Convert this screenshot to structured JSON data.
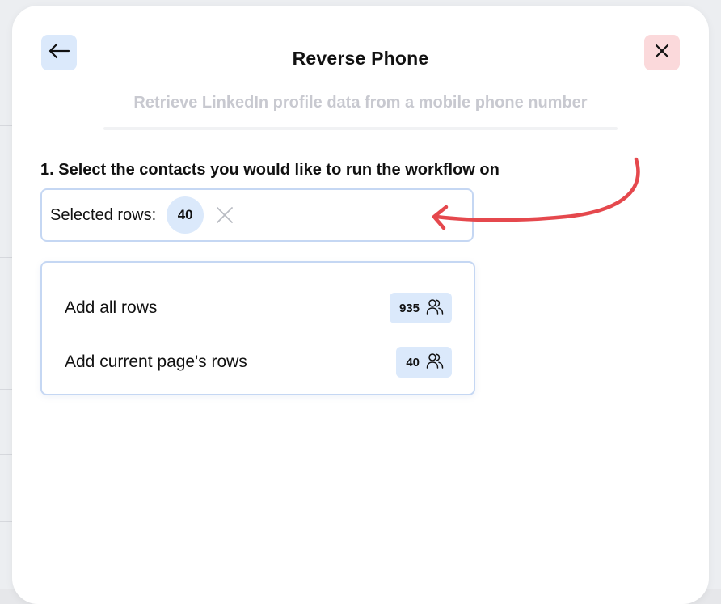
{
  "modal": {
    "title": "Reverse Phone",
    "subtitle": "Retrieve LinkedIn profile data from a mobile phone number"
  },
  "icons": {
    "back": "arrow-left-icon",
    "close": "close-icon",
    "clear": "clear-x-icon",
    "users": "users-icon"
  },
  "step": {
    "label": "1. Select the contacts you would like to run the workflow on"
  },
  "selector": {
    "label": "Selected rows:",
    "selected_count": "40"
  },
  "options": [
    {
      "label": "Add all rows",
      "count": "935"
    },
    {
      "label": "Add current page's rows",
      "count": "40"
    }
  ],
  "colors": {
    "accent_blue": "#dbe9fb",
    "close_red": "#fbd9db",
    "annotation_arrow": "#e5484d",
    "border_blue": "#c5d7f3"
  }
}
